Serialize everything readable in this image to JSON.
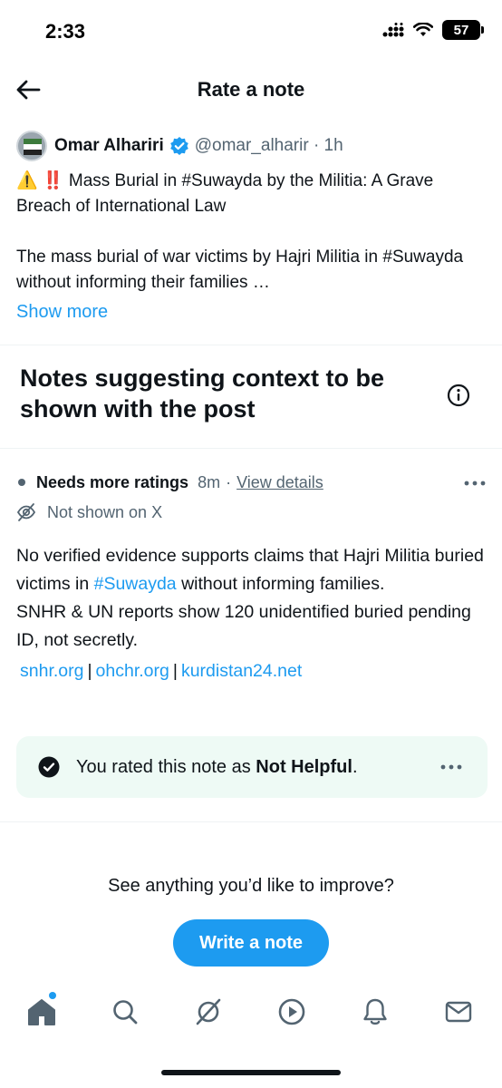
{
  "status_bar": {
    "time": "2:33",
    "battery": "57"
  },
  "header": {
    "title": "Rate a note",
    "back_icon": "arrow-left-icon"
  },
  "post": {
    "author_name": "Omar Alhariri",
    "author_handle": "@omar_alharir · 1h",
    "text": "⚠️ ‼️ Mass Burial in #Suwayda by the Militia: A Grave Breach of International Law\n\nThe mass burial of war victims by Hajri Militia in #Suwayda without informing their families …",
    "show_more": "Show more"
  },
  "notes_section": {
    "heading": "Notes suggesting context to be shown with the post"
  },
  "note": {
    "status": "Needs more ratings",
    "time": "8m",
    "separator": "·",
    "view_details": "View details",
    "visibility": "Not shown on X",
    "body_part1": "No verified evidence supports claims that Hajri Militia buried victims in ",
    "body_hashtag": "#Suwayda",
    "body_part2": " without informing families.\nSNHR & UN reports show 120 unidentified buried pending ID, not secretly.",
    "links": [
      "snhr.org",
      "ohchr.org",
      "kurdistan24.net"
    ],
    "link_separator": "|"
  },
  "rating": {
    "prefix": "You rated this note as ",
    "value": "Not Helpful",
    "suffix": "."
  },
  "improve": {
    "prompt": "See anything you’d like to improve?",
    "button": "Write a note"
  },
  "tabbar": {
    "items": [
      "home-icon",
      "search-icon",
      "communities-icon",
      "video-icon",
      "notifications-icon",
      "messages-icon"
    ]
  },
  "colors": {
    "accent": "#1d9bf0",
    "rating_bg": "#eefaf5",
    "muted": "#536471"
  }
}
